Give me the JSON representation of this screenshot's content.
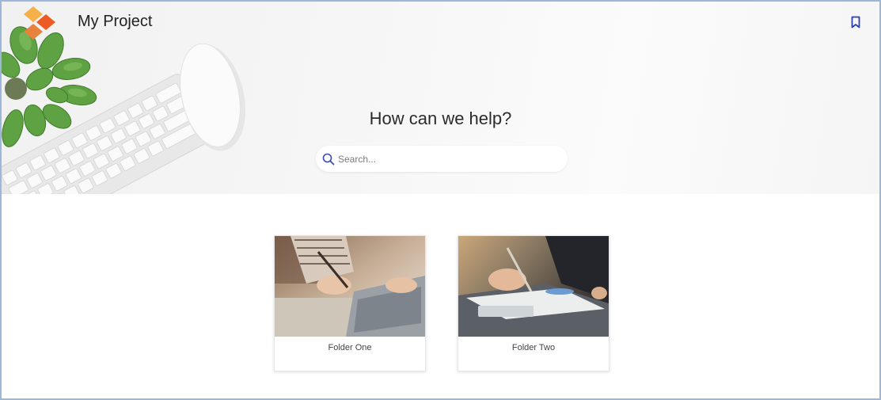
{
  "header": {
    "project_title": "My Project",
    "logo_icon": "diamond-logo-icon",
    "bookmark_icon": "bookmark-icon",
    "logo_colors": [
      "#f6b04a",
      "#ee6a2e",
      "#e8823c"
    ],
    "bookmark_color": "#2b3fb3"
  },
  "hero": {
    "heading": "How can we help?",
    "decorations": [
      "plant",
      "keyboard",
      "mouse"
    ]
  },
  "search": {
    "placeholder": "Search...",
    "value": "",
    "icon": "search-icon",
    "icon_color": "#3a4bb8"
  },
  "folders": [
    {
      "label": "Folder One",
      "image": "person-writing-notebook-laptop"
    },
    {
      "label": "Folder Two",
      "image": "person-writing-on-documents"
    }
  ],
  "colors": {
    "border": "#9db7d9"
  }
}
